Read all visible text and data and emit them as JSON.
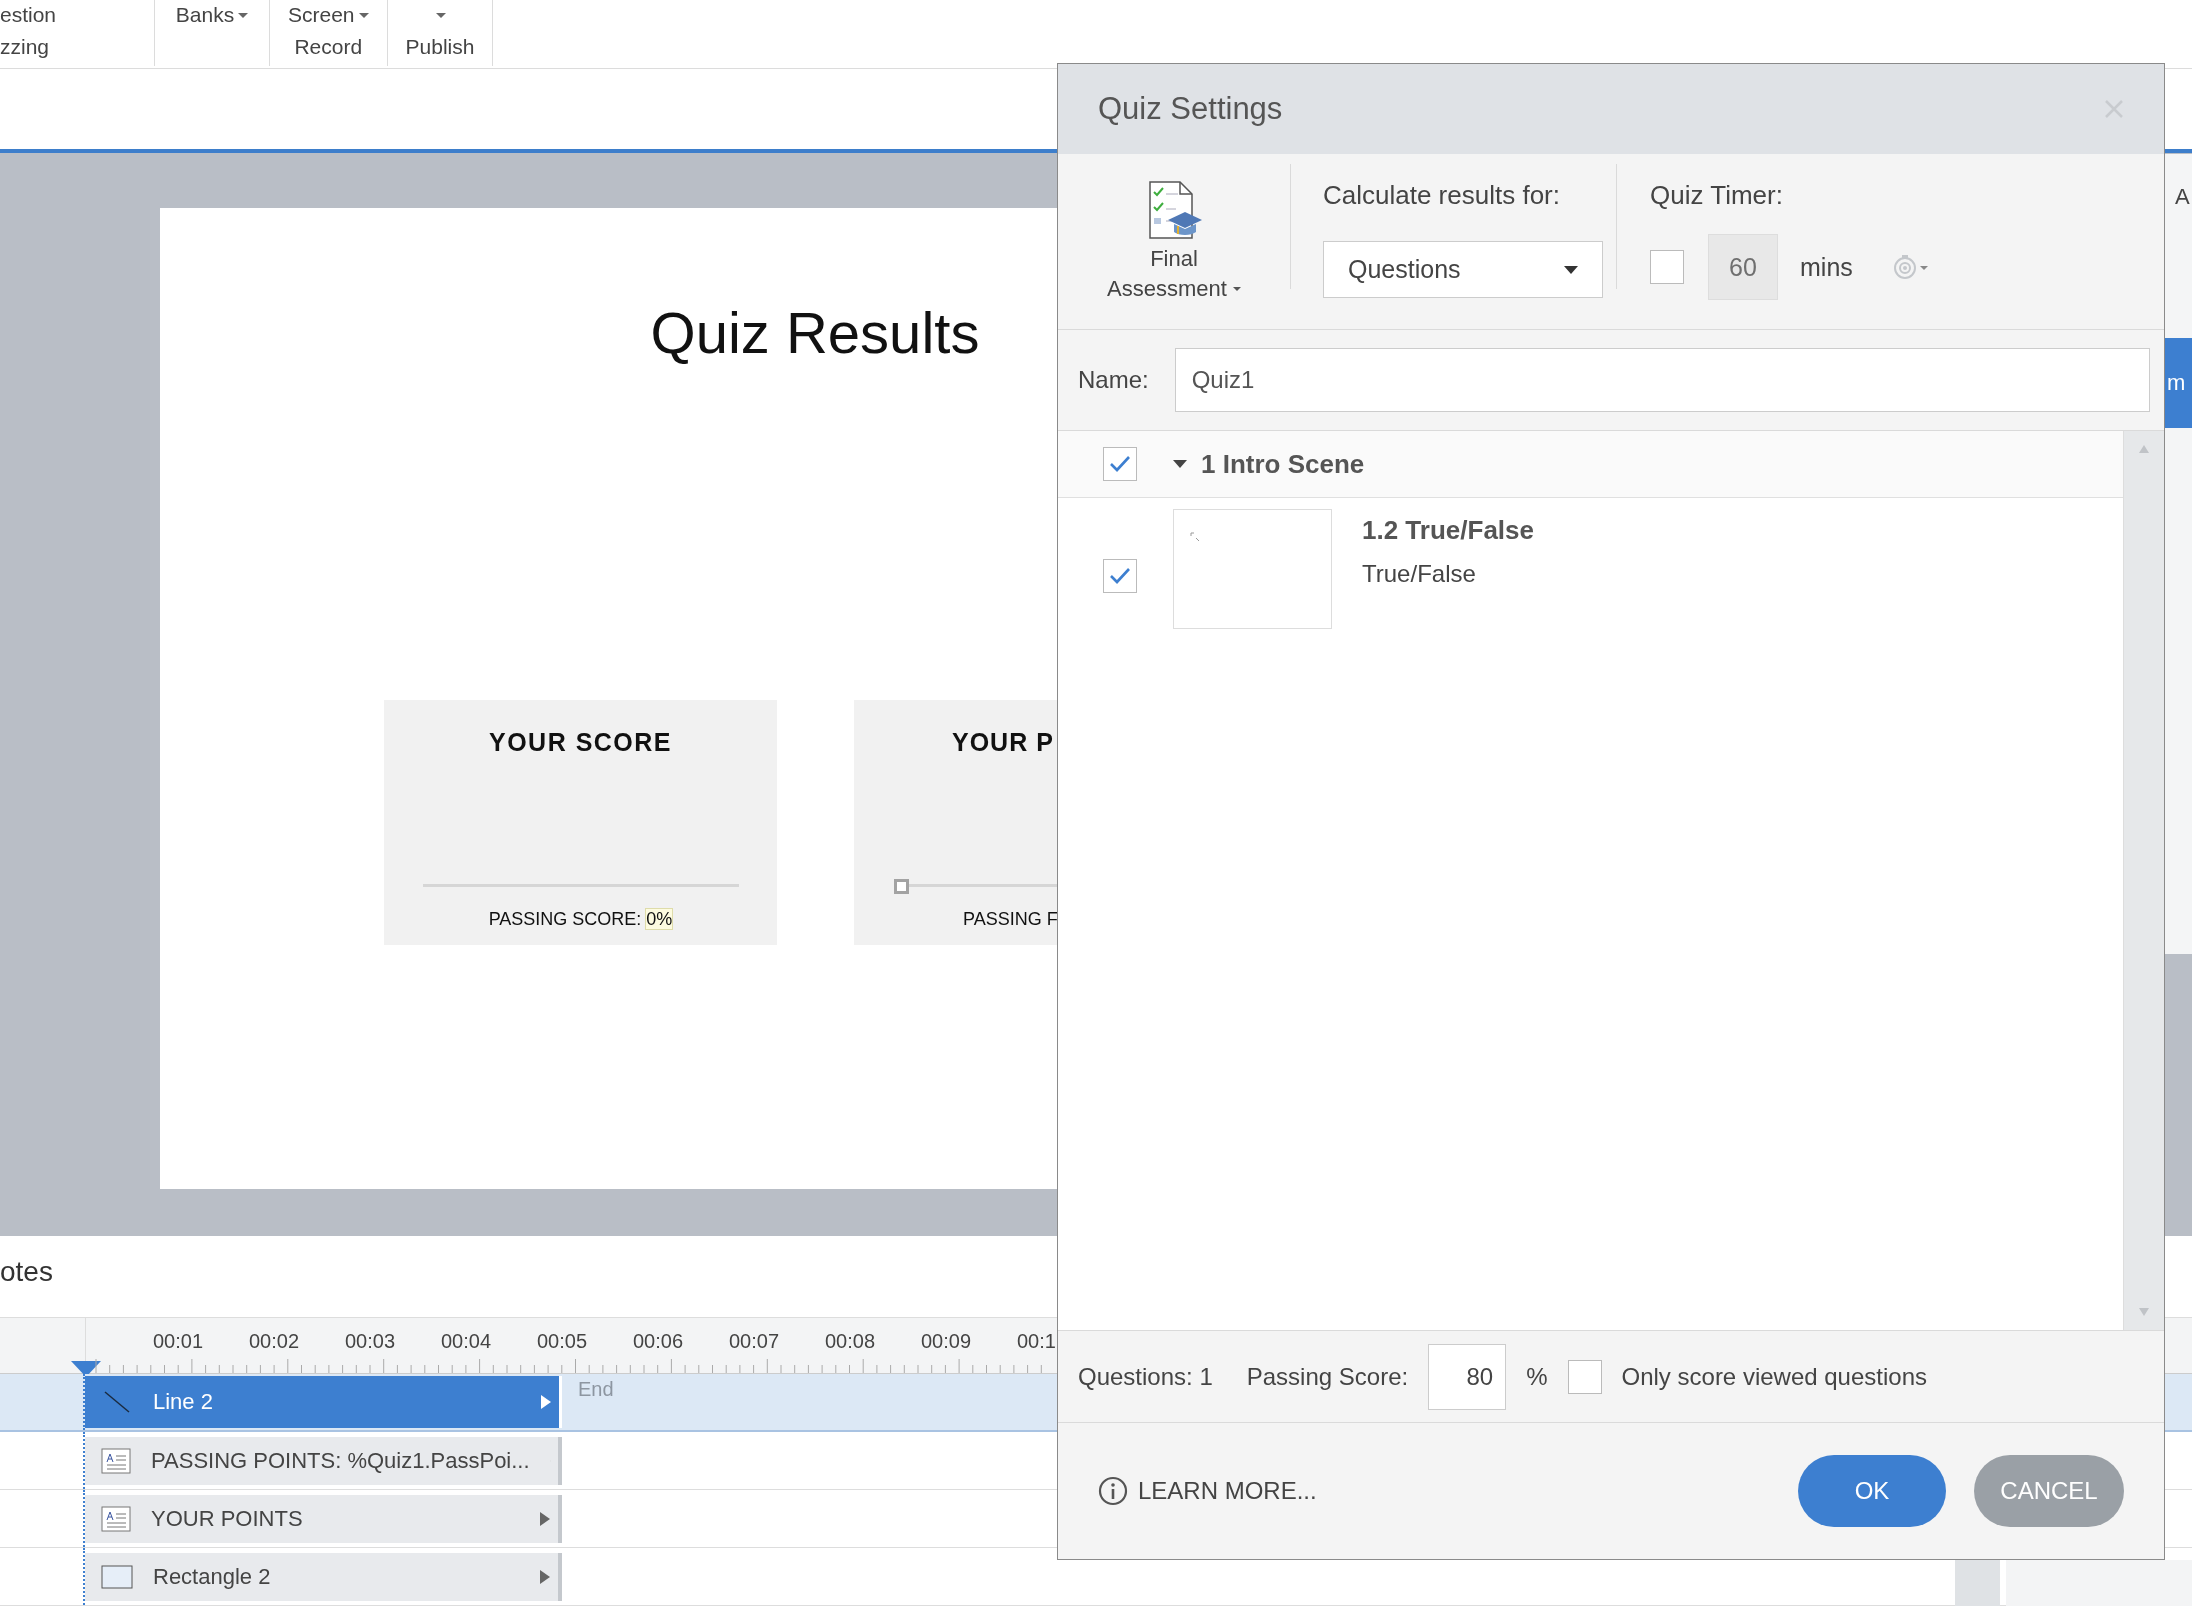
{
  "toolbar": {
    "buttons": [
      {
        "line1": "estion",
        "line2": "zzing",
        "caret": false
      },
      {
        "line1": "Banks",
        "caret": true
      },
      {
        "line1": "Screen",
        "line2": "Record",
        "caret": true
      },
      {
        "line2": "Publish",
        "caret": true
      }
    ]
  },
  "slide": {
    "title": "Quiz Results",
    "cards": [
      {
        "heading": "YOUR SCORE",
        "footer_prefix": "PASSING SCORE: ",
        "footer_value": "0%",
        "handle": false
      },
      {
        "heading": "YOUR P",
        "footer_prefix": "PASSING F",
        "handle": true
      }
    ]
  },
  "notes": {
    "label": "otes"
  },
  "timeline": {
    "ticks": [
      "00:01",
      "00:02",
      "00:03",
      "00:04",
      "00:05",
      "00:06",
      "00:07",
      "00:08",
      "00:09",
      "00:1"
    ],
    "end_label": "End",
    "tracks": [
      {
        "kind": "line",
        "label": "Line 2",
        "selected": true
      },
      {
        "kind": "text",
        "label": "PASSING POINTS: %Quiz1.PassPoi...",
        "selected": false
      },
      {
        "kind": "text",
        "label": "YOUR POINTS",
        "selected": false
      },
      {
        "kind": "shape",
        "label": "Rectangle 2",
        "selected": false
      }
    ]
  },
  "side_panel": {
    "top_label": "A",
    "tab_label": "m"
  },
  "dialog": {
    "title": "Quiz Settings",
    "assessment": {
      "line1": "Final",
      "line2": "Assessment"
    },
    "calculate": {
      "label": "Calculate results for:",
      "value": "Questions"
    },
    "timer": {
      "label": "Quiz Timer:",
      "checked": false,
      "value": "60",
      "unit": "mins"
    },
    "name": {
      "label": "Name:",
      "value": "Quiz1"
    },
    "tree": [
      {
        "label": "1 Intro Scene",
        "checked": true,
        "expanded": true,
        "children": [
          {
            "title": "1.2 True/False",
            "subtitle": "True/False",
            "checked": true
          }
        ]
      }
    ],
    "footer": {
      "questions": "Questions: 1",
      "passing_label": "Passing Score:",
      "passing_value": "80",
      "percent": "%",
      "only_viewed": {
        "label": "Only score viewed questions",
        "checked": false
      }
    },
    "learn_more": "LEARN MORE...",
    "ok": "OK",
    "cancel": "CANCEL"
  }
}
